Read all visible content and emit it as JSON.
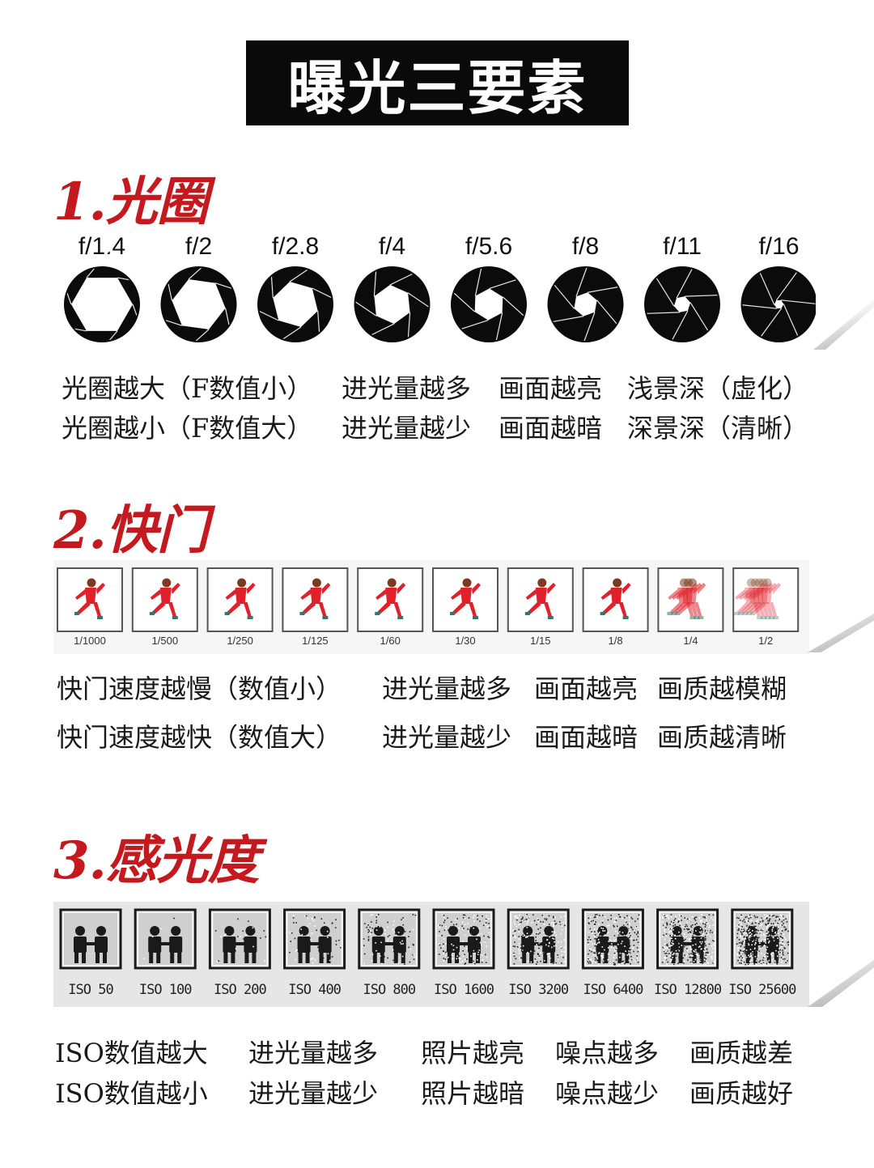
{
  "title": "曝光三要素",
  "sections": {
    "aperture": {
      "heading": "1.光圈",
      "stops": [
        "f/1.4",
        "f/2",
        "f/2.8",
        "f/4",
        "f/5.6",
        "f/8",
        "f/11",
        "f/16"
      ],
      "rows": [
        [
          "光圈越大（F数值小）",
          "进光量越多",
          "画面越亮",
          "浅景深（虚化）"
        ],
        [
          "光圈越小（F数值大）",
          "进光量越少",
          "画面越暗",
          "深景深（清晰）"
        ]
      ]
    },
    "shutter": {
      "heading": "2.快门",
      "speeds": [
        "1/1000",
        "1/500",
        "1/250",
        "1/125",
        "1/60",
        "1/30",
        "1/15",
        "1/8",
        "1/4",
        "1/2"
      ],
      "rows": [
        [
          "快门速度越慢（数值小）",
          "进光量越多",
          "画面越亮",
          "画质越模糊"
        ],
        [
          "快门速度越快（数值大）",
          "进光量越少",
          "画面越暗",
          "画质越清晰"
        ]
      ]
    },
    "iso": {
      "heading": "3.感光度",
      "values": [
        "ISO 50",
        "ISO 100",
        "ISO 200",
        "ISO 400",
        "ISO 800",
        "ISO 1600",
        "ISO 3200",
        "ISO 6400",
        "ISO 12800",
        "ISO 25600"
      ],
      "rows": [
        [
          "ISO数值越大",
          "进光量越多",
          "照片越亮",
          "噪点越多",
          "画质越差"
        ],
        [
          "ISO数值越小",
          "进光量越少",
          "照片越暗",
          "噪点越少",
          "画质越好"
        ]
      ]
    }
  },
  "colors": {
    "accent": "#c41a1f",
    "runner": "#e0202a",
    "title_bg": "#0a0a0a"
  }
}
